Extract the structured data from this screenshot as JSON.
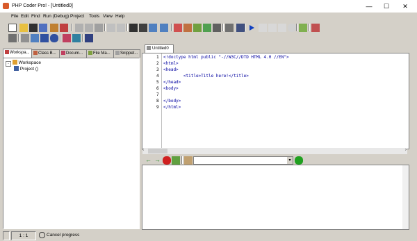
{
  "window": {
    "title": "PHP Coder Pro! - [Untitled0]",
    "controls": {
      "minimize": "—",
      "maximize": "☐",
      "close": "✕"
    }
  },
  "menu": [
    "File",
    "Edit",
    "Find",
    "Run (Debug)",
    "Project",
    "Tools",
    "View",
    "Help"
  ],
  "left_tabs": [
    "Workspa...",
    "Class B...",
    "Docum...",
    "File Ma...",
    "Snippet..."
  ],
  "tree": {
    "root": "Workspace",
    "child": "Project ()"
  },
  "editor": {
    "tab": "Untitled0",
    "line_numbers": [
      "1",
      "2",
      "3",
      "4",
      "5",
      "6",
      "7",
      "8",
      "9"
    ],
    "lines": [
      "<!doctype html public \"-//W3C//DTD HTML 4.0 //EN\">",
      "<html>",
      "<head>",
      "        <title>Title here!</title>",
      "</head>",
      "<body>",
      "",
      "</body>",
      "</html>"
    ]
  },
  "status": {
    "position": "1 : 1",
    "message": "Cancel progress"
  },
  "colors": {
    "code": "#0000a0",
    "string": "#008000",
    "tag": "#0000ff"
  }
}
